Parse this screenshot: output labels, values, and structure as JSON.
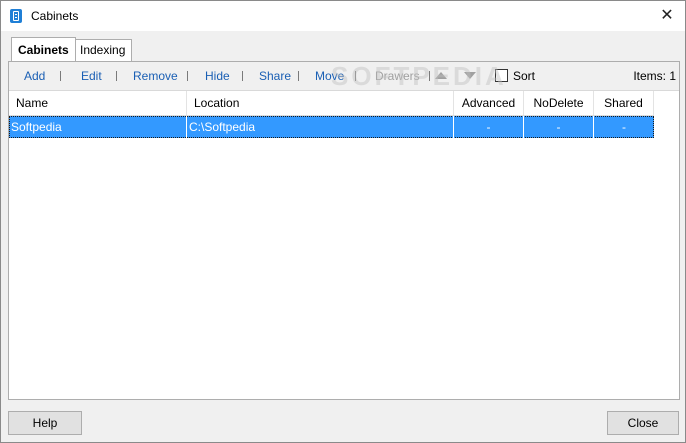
{
  "window": {
    "title": "Cabinets",
    "close_glyph": "✕"
  },
  "tabs": [
    {
      "label": "Cabinets",
      "active": true
    },
    {
      "label": "Indexing",
      "active": false
    }
  ],
  "toolbar": {
    "add": "Add",
    "edit": "Edit",
    "remove": "Remove",
    "hide": "Hide",
    "share": "Share",
    "move": "Move",
    "drawers": "Drawers",
    "sort_label": "Sort",
    "sort_checked": false,
    "items_label": "Items: 1"
  },
  "table": {
    "columns": [
      "Name",
      "Location",
      "Advanced",
      "NoDelete",
      "Shared"
    ],
    "rows": [
      {
        "name": "Softpedia",
        "location": "C:\\Softpedia",
        "advanced": "-",
        "nodelete": "-",
        "shared": "-",
        "selected": true
      }
    ]
  },
  "buttons": {
    "help": "Help",
    "close": "Close"
  },
  "watermark": "SOFTPEDIA",
  "colors": {
    "selection": "#3399ff",
    "link": "#1a5fb4",
    "disabled": "#a0a0a0"
  },
  "icons": {
    "app": "cabinet-icon",
    "close": "close-icon",
    "move_up": "move-up-icon",
    "move_down": "move-down-icon"
  }
}
